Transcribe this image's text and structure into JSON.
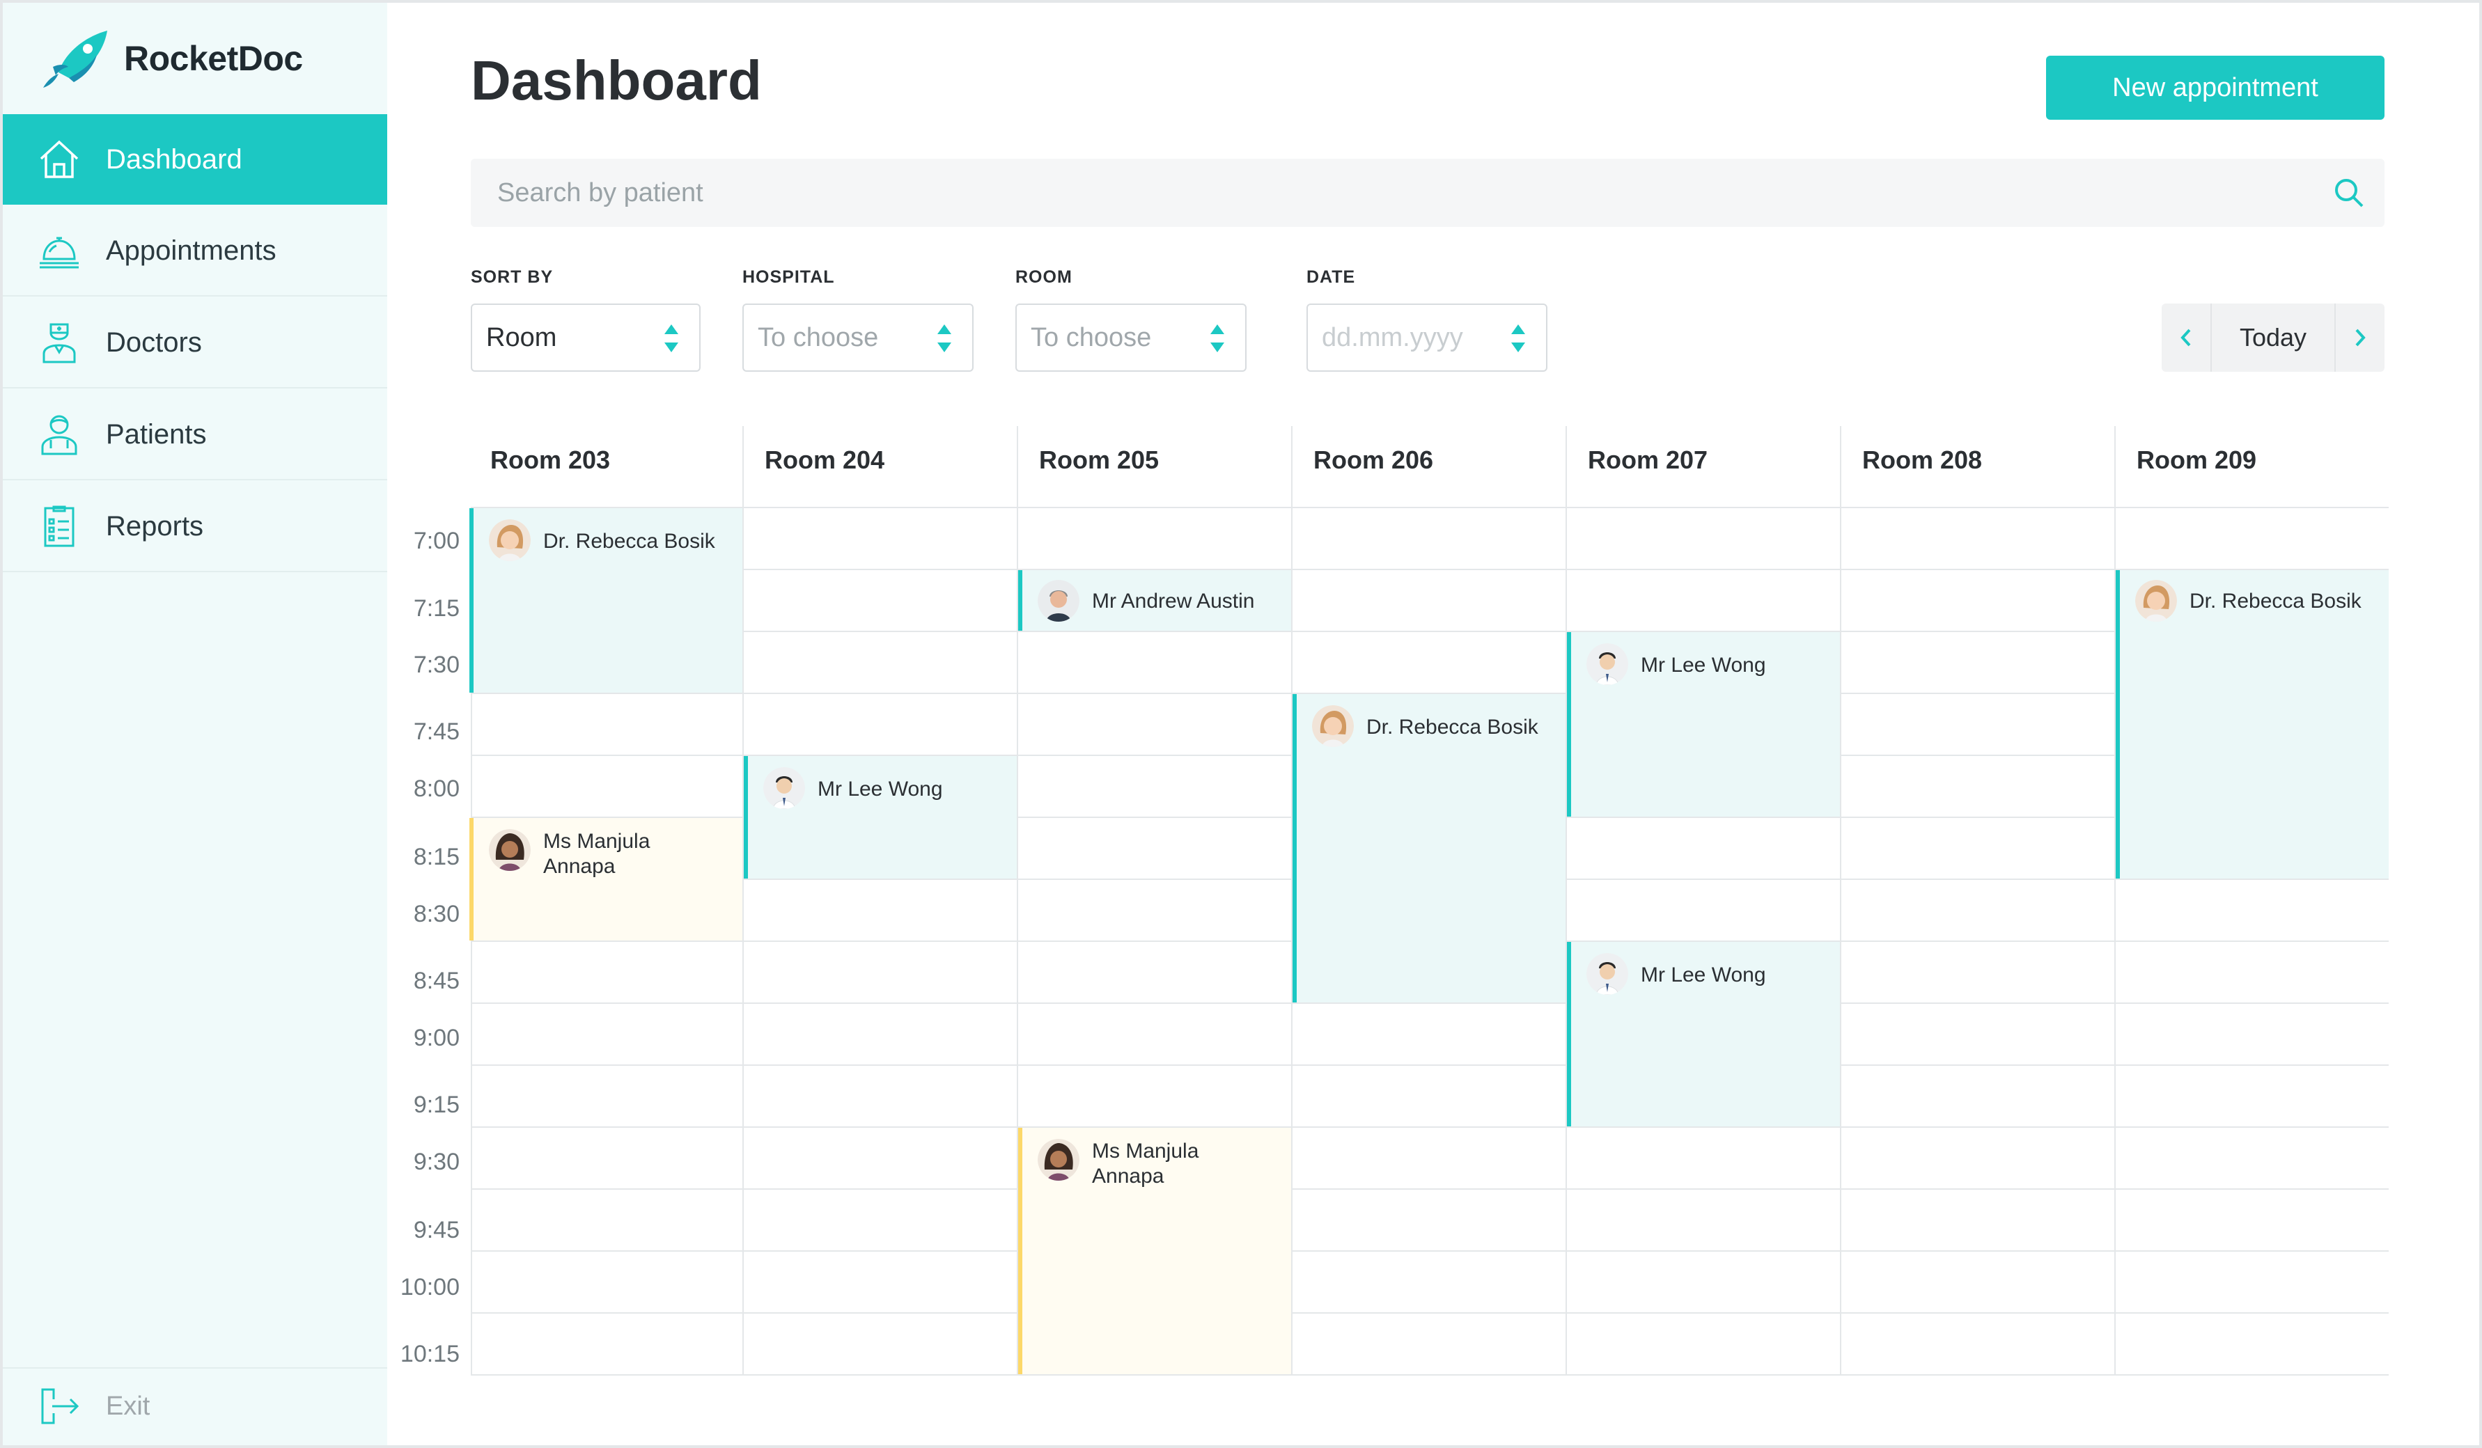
{
  "app": {
    "name": "RocketDoc"
  },
  "sidebar": {
    "items": [
      {
        "label": "Dashboard",
        "icon": "home-icon",
        "active": true
      },
      {
        "label": "Appointments",
        "icon": "reception-bell-icon",
        "active": false
      },
      {
        "label": "Doctors",
        "icon": "doctor-icon",
        "active": false
      },
      {
        "label": "Patients",
        "icon": "patient-icon",
        "active": false
      },
      {
        "label": "Reports",
        "icon": "report-list-icon",
        "active": false
      }
    ],
    "exit_label": "Exit"
  },
  "header": {
    "title": "Dashboard",
    "new_button": "New appointment"
  },
  "search": {
    "placeholder": "Search by patient"
  },
  "filters": {
    "sort_by": {
      "label": "SORT BY",
      "value": "Room"
    },
    "hospital": {
      "label": "HOSPITAL",
      "value": "To choose"
    },
    "room": {
      "label": "ROOM",
      "value": "To choose"
    },
    "date": {
      "label": "DATE",
      "value": "dd.mm.yyyy"
    }
  },
  "day_nav": {
    "today_label": "Today"
  },
  "schedule": {
    "rooms": [
      "Room 203",
      "Room 204",
      "Room 205",
      "Room 206",
      "Room 207",
      "Room 208",
      "Room 209"
    ],
    "times": [
      "7:00",
      "7:15",
      "7:30",
      "7:45",
      "8:00",
      "8:15",
      "8:30",
      "8:45",
      "9:00",
      "9:15",
      "9:30",
      "9:45",
      "10:00",
      "10:15"
    ],
    "appointments": [
      {
        "room": "Room 203",
        "start": "7:00",
        "end": "7:45",
        "name": "Dr. Rebecca Bosik",
        "status": "teal"
      },
      {
        "room": "Room 203",
        "start": "8:15",
        "end": "8:45",
        "name": "Ms Manjula Annapa",
        "status": "yellow"
      },
      {
        "room": "Room 204",
        "start": "8:00",
        "end": "8:30",
        "name": "Mr Lee Wong",
        "status": "teal"
      },
      {
        "room": "Room 205",
        "start": "7:15",
        "end": "7:30",
        "name": "Mr Andrew Austin",
        "status": "teal"
      },
      {
        "room": "Room 205",
        "start": "9:30",
        "end": "10:30",
        "name": "Ms Manjula Annapa",
        "status": "yellow"
      },
      {
        "room": "Room 206",
        "start": "7:45",
        "end": "9:00",
        "name": "Dr. Rebecca Bosik",
        "status": "teal"
      },
      {
        "room": "Room 207",
        "start": "7:30",
        "end": "8:15",
        "name": "Mr Lee Wong",
        "status": "teal"
      },
      {
        "room": "Room 207",
        "start": "8:45",
        "end": "9:30",
        "name": "Mr Lee Wong",
        "status": "teal"
      },
      {
        "room": "Room 209",
        "start": "7:15",
        "end": "8:30",
        "name": "Dr. Rebecca Bosik",
        "status": "teal"
      }
    ]
  },
  "colors": {
    "accent": "#1cc8c3",
    "pending": "#fcd869",
    "sidebar_bg": "#f0fafa"
  }
}
